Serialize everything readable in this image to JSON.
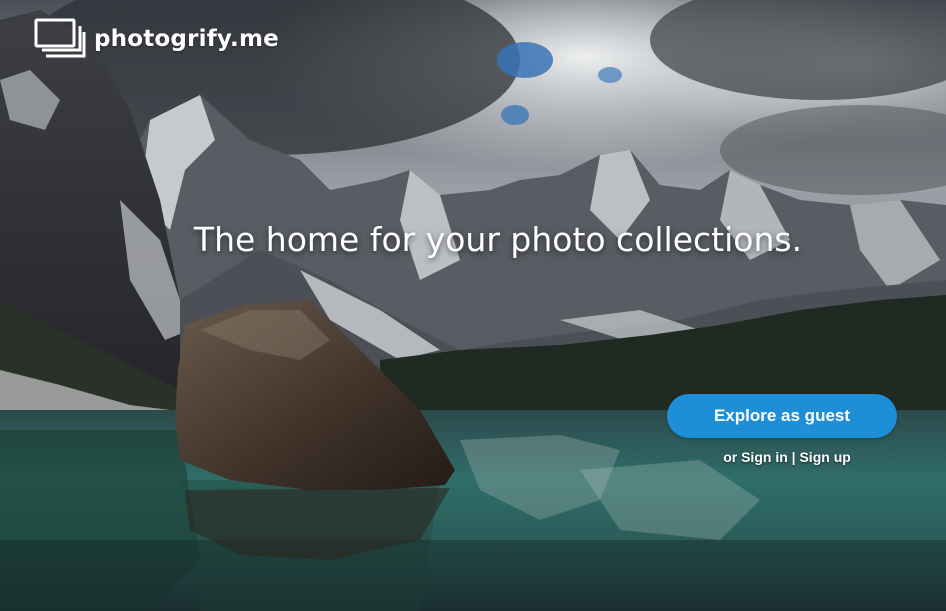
{
  "brand": {
    "name": "photogrify.me",
    "logo_icon": "photo-stack-icon"
  },
  "hero": {
    "headline": "The home for your photo collections.",
    "background": "mountain-lake-photo"
  },
  "actions": {
    "explore_label": "Explore as guest",
    "or_text": "or",
    "sign_in_label": "Sign in",
    "separator": "|",
    "sign_up_label": "Sign up"
  },
  "colors": {
    "accent": "#1e8ed7",
    "text": "#ffffff"
  }
}
